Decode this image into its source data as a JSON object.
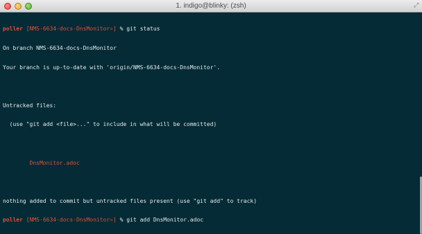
{
  "window": {
    "title": "1. indigo@blinky: (zsh)"
  },
  "terminal": {
    "prompt_user": "poller",
    "prompt_branch": "[NMS-6634-docs-DnsMonitor",
    "prompt_branch_status": "»",
    "prompt_close": "]",
    "prompt_symbol": "%",
    "cmd1": "git status",
    "out_branch": "On branch NMS-6634-docs-DnsMonitor",
    "out_uptodate": "Your branch is up-to-date with 'origin/NMS-6634-docs-DnsMonitor'.",
    "out_untracked_header": "Untracked files:",
    "out_untracked_hint": "  (use \"git add <file>...\" to include in what will be committed)",
    "out_untracked_file": "        DnsMonitor.adoc",
    "out_nothing_added": "nothing added to commit but untracked files present (use \"git add\" to track)",
    "cmd2": "git add DnsMonitor.adoc",
    "cmd3": ""
  },
  "colors": {
    "background": "#042b36",
    "foreground": "#e6ebeb",
    "prompt": "#e0503a"
  }
}
